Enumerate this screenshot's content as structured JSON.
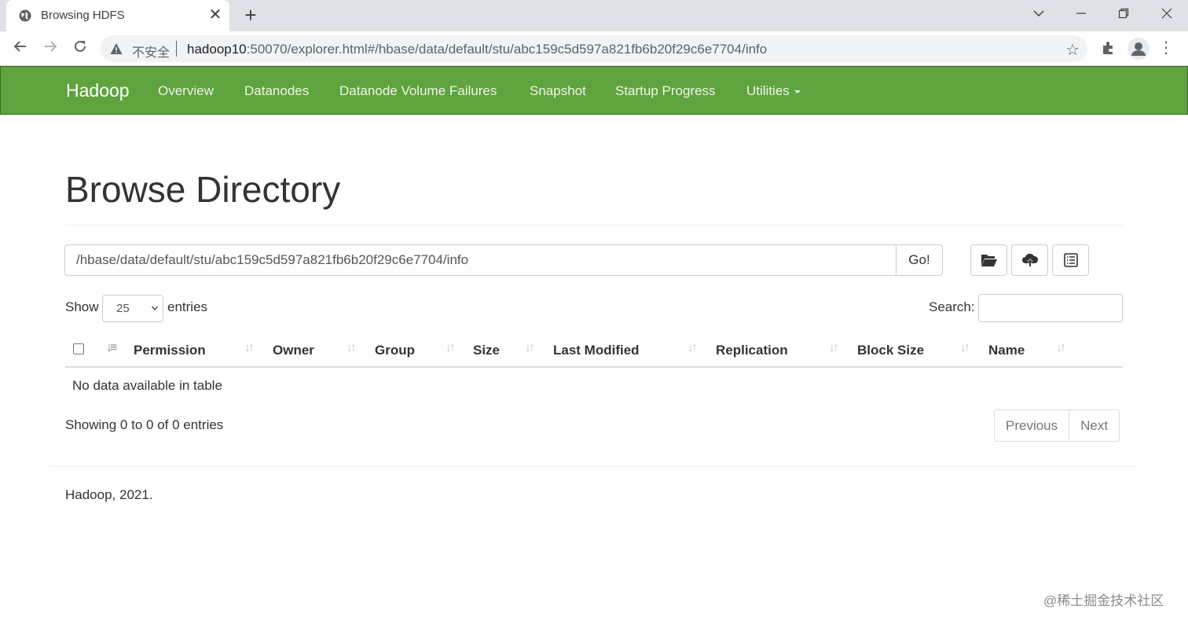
{
  "browser": {
    "tab_title": "Browsing HDFS",
    "tab_close": "✕",
    "new_tab": "+",
    "omnibox": {
      "security_label": "不安全",
      "url_host": "hadoop10",
      "url_rest": ":50070/explorer.html#/hbase/data/default/stu/abc159c5d597a821fb6b20f29c6e7704/info"
    }
  },
  "navbar": {
    "brand": "Hadoop",
    "items": [
      "Overview",
      "Datanodes",
      "Datanode Volume Failures",
      "Snapshot",
      "Startup Progress",
      "Utilities"
    ]
  },
  "page": {
    "title": "Browse Directory",
    "path_value": "/hbase/data/default/stu/abc159c5d597a821fb6b20f29c6e7704/info",
    "go_label": "Go!",
    "show_label": "Show",
    "entries_value": "25",
    "entries_label": "entries",
    "search_label": "Search:",
    "columns": [
      "Permission",
      "Owner",
      "Group",
      "Size",
      "Last Modified",
      "Replication",
      "Block Size",
      "Name"
    ],
    "empty_message": "No data available in table",
    "info": "Showing 0 to 0 of 0 entries",
    "pager": {
      "previous": "Previous",
      "next": "Next"
    },
    "footer": "Hadoop, 2021."
  },
  "watermark": "@稀土掘金技术社区",
  "colors": {
    "navbar_bg": "#5fa33e",
    "navbar_text": "#eef6e9"
  }
}
